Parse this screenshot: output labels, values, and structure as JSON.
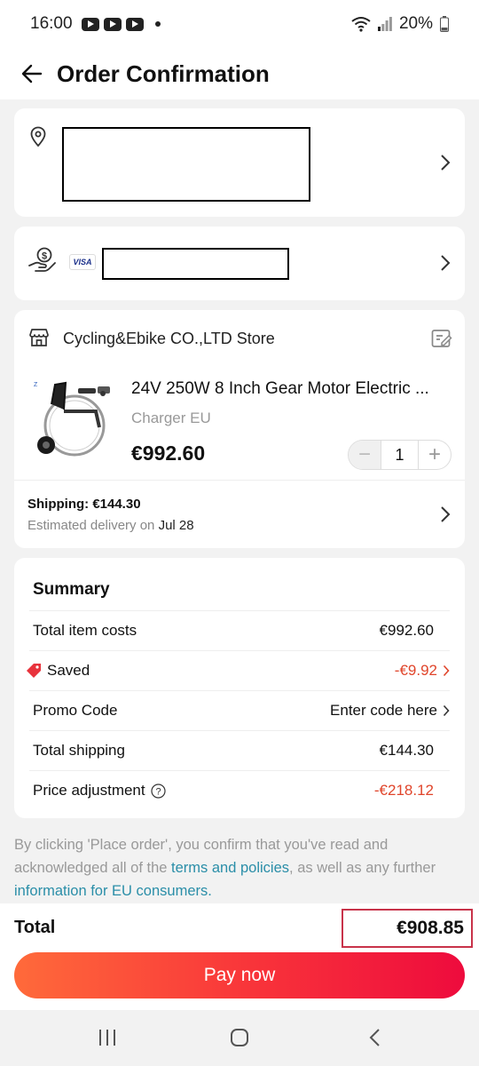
{
  "status_bar": {
    "time": "16:00",
    "battery": "20%"
  },
  "header": {
    "title": "Order Confirmation"
  },
  "store": {
    "name": "Cycling&Ebike CO.,LTD Store"
  },
  "payment": {
    "card_brand": "VISA"
  },
  "product": {
    "title": "24V 250W 8 Inch Gear Motor Electric ...",
    "variant": "Charger EU",
    "price": "€992.60",
    "quantity": "1"
  },
  "shipping": {
    "label": "Shipping: €144.30",
    "estimated_prefix": "Estimated delivery on",
    "date": "Jul 28"
  },
  "summary": {
    "title": "Summary",
    "rows": [
      {
        "label": "Total item costs",
        "value": "€992.60"
      },
      {
        "label": "Saved",
        "value": "-€9.92"
      },
      {
        "label": "Promo Code",
        "value": "Enter code here"
      },
      {
        "label": "Total shipping",
        "value": "€144.30"
      },
      {
        "label": "Price adjustment",
        "value": "-€218.12"
      }
    ]
  },
  "legal": {
    "text_1": "By clicking 'Place order', you confirm that you've read and acknowledged all of the",
    "link_1": "terms and policies",
    "text_2": ", as well as any further",
    "link_2": "information for EU consumers",
    "text_3": "."
  },
  "total": {
    "label": "Total",
    "value": "€908.85"
  },
  "pay_button": {
    "label": "Pay now"
  },
  "colors": {
    "accent_red": "#e0452b",
    "link": "#2a8ea8",
    "button_start": "#ff6a3a",
    "button_end": "#ee0b3d"
  }
}
